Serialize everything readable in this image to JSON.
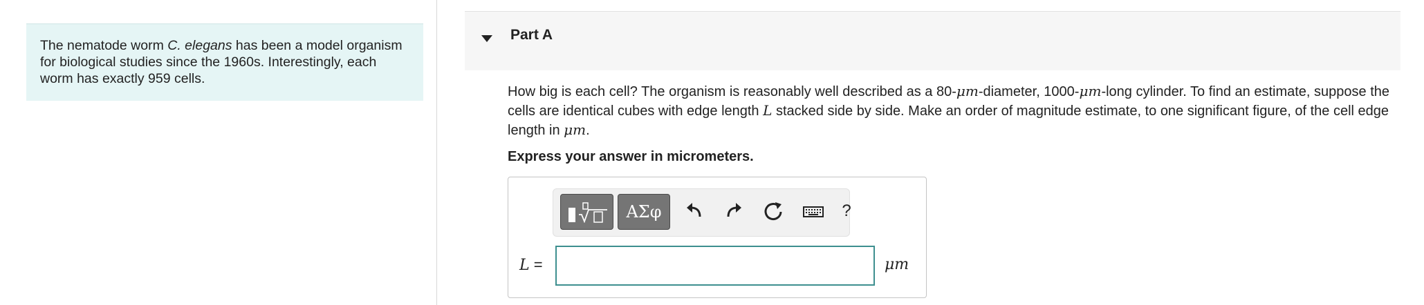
{
  "intro": {
    "text_before": "The nematode worm ",
    "species": "C. elegans",
    "text_after": " has been a model organism for biological studies since the 1960s. Interestingly, each worm has exactly 959 cells."
  },
  "part": {
    "title": "Part A",
    "expanded": true
  },
  "question": {
    "t1": "How big is each cell? The organism is reasonably well described as a 80-",
    "mu1": "μm",
    "t2": "-diameter, 1000-",
    "mu2": "μm",
    "t3": "-long cylinder. To find an estimate, suppose the cells are identical cubes with edge length ",
    "var": "L",
    "t4": " stacked side by side. Make an order of magnitude estimate, to one significant figure, of the cell edge length in ",
    "mu3": "μm",
    "t5": "."
  },
  "instruction": "Express your answer in micrometers.",
  "toolbar": {
    "templates_icon": "templates-icon",
    "symbols_label": "ΑΣφ",
    "undo_icon": "undo-icon",
    "redo_icon": "redo-icon",
    "reset_icon": "reset-icon",
    "keyboard_icon": "keyboard-icon",
    "help_label": "?"
  },
  "answer": {
    "variable": "L",
    "equals": "=",
    "value": "",
    "unit": "μm"
  },
  "colors": {
    "intro_bg": "#e5f5f5",
    "header_bg": "#f6f6f6",
    "input_border": "#3d8f8f",
    "toolbar_button_dark": "#757575"
  }
}
